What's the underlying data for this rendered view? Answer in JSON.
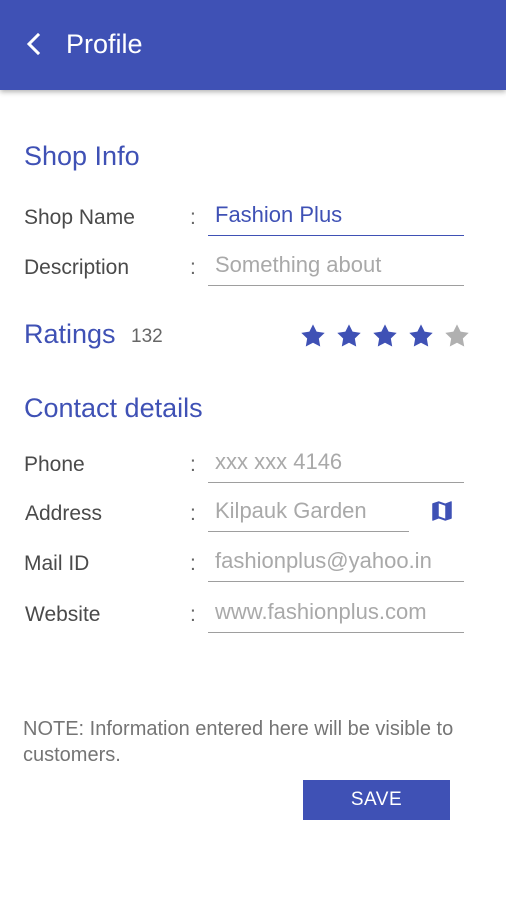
{
  "appbar": {
    "title": "Profile",
    "back_icon": "chevron-left-icon",
    "background": "#3f51b5"
  },
  "shop_info": {
    "title": "Shop Info",
    "shop_name": {
      "label": "Shop Name",
      "colon": ":",
      "value": "Fashion Plus"
    },
    "description": {
      "label": "Description",
      "colon": ":",
      "placeholder": "Something about"
    }
  },
  "ratings": {
    "label": "Ratings",
    "count": "132",
    "stars_filled": 4,
    "stars_total": 5,
    "filled_color": "#3f51b5",
    "empty_color": "#b0b0b0"
  },
  "contact": {
    "title": "Contact details",
    "phone": {
      "label": "Phone",
      "colon": ":",
      "placeholder": "xxx xxx 4146"
    },
    "address": {
      "label": "Address",
      "colon": ":",
      "placeholder": "Kilpauk Garden",
      "icon": "map-icon"
    },
    "mail": {
      "label": "Mail ID",
      "colon": ":",
      "placeholder": "fashionplus@yahoo.in"
    },
    "website": {
      "label": "Website",
      "colon": ":",
      "placeholder": "www.fashionplus.com"
    }
  },
  "note": "NOTE: Information entered here will be visible to customers.",
  "save_label": "SAVE",
  "accent_color": "#3f51b5"
}
